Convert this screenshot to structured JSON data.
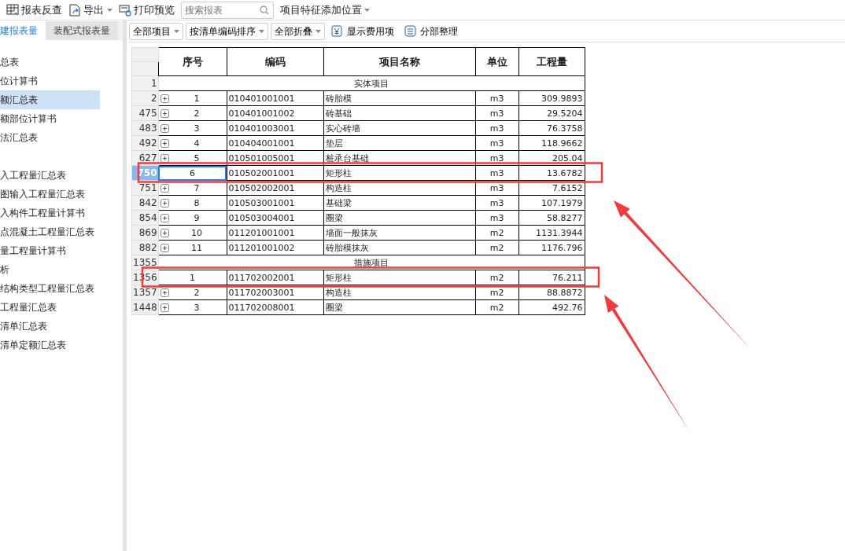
{
  "toolbar": {
    "items": [
      {
        "kind": "button",
        "label": "报表反查"
      },
      {
        "kind": "dropdown",
        "label": "导出"
      },
      {
        "kind": "button",
        "label": "打印预览"
      },
      {
        "kind": "search",
        "placeholder": "搜索报表"
      },
      {
        "kind": "select",
        "label": "项目特征添加位置"
      }
    ]
  },
  "sidebar": {
    "tabs": [
      {
        "label": "建报表量",
        "selected": true
      },
      {
        "label": "装配式报表量",
        "selected": false
      }
    ],
    "items": [
      {
        "label": "总表",
        "selected": false
      },
      {
        "label": "位计算书",
        "selected": false
      },
      {
        "label": "额汇总表",
        "selected": true
      },
      {
        "label": "额部位计算书",
        "selected": false
      },
      {
        "label": "法汇总表",
        "selected": false
      },
      {
        "label": "入工程量汇总表",
        "selected": false
      },
      {
        "label": "图输入工程量汇总表",
        "selected": false
      },
      {
        "label": "入构件工程量计算书",
        "selected": false
      },
      {
        "label": "点混凝土工程量汇总表",
        "selected": false
      },
      {
        "label": "量工程量计算书",
        "selected": false
      },
      {
        "label": "析",
        "selected": false
      },
      {
        "label": "结构类型工程量汇总表",
        "selected": false
      },
      {
        "label": "工程量汇总表",
        "selected": false
      },
      {
        "label": "清单汇总表",
        "selected": false
      },
      {
        "label": "清单定额汇总表",
        "selected": false
      }
    ]
  },
  "filters": [
    {
      "kind": "select",
      "label": "全部项目"
    },
    {
      "kind": "select",
      "label": "按清单编码排序"
    },
    {
      "kind": "select",
      "label": "全部折叠"
    },
    {
      "kind": "button",
      "label": "显示费用项"
    },
    {
      "kind": "button",
      "label": "分部整理"
    }
  ],
  "table": {
    "columns": [
      "序号",
      "编码",
      "项目名称",
      "单位",
      "工程量"
    ],
    "rows": [
      {
        "kind": "group",
        "row_number": "1",
        "label": "实体项目"
      },
      {
        "kind": "item",
        "row_number": "2",
        "expand_button": true,
        "selected": false,
        "index": "1",
        "code": "010401001001",
        "name": "砖胎模",
        "unit": "m3",
        "quantity": "309.9893"
      },
      {
        "kind": "item",
        "row_number": "475",
        "expand_button": true,
        "selected": false,
        "index": "2",
        "code": "010401001002",
        "name": "砖基础",
        "unit": "m3",
        "quantity": "29.5204"
      },
      {
        "kind": "item",
        "row_number": "483",
        "expand_button": true,
        "selected": false,
        "index": "3",
        "code": "010401003001",
        "name": "实心砖墙",
        "unit": "m3",
        "quantity": "76.3758"
      },
      {
        "kind": "item",
        "row_number": "492",
        "expand_button": true,
        "selected": false,
        "index": "4",
        "code": "010404001001",
        "name": "垫层",
        "unit": "m3",
        "quantity": "118.9662"
      },
      {
        "kind": "item",
        "row_number": "627",
        "expand_button": true,
        "selected": false,
        "index": "5",
        "code": "010501005001",
        "name": "桩承台基础",
        "unit": "m3",
        "quantity": "205.04"
      },
      {
        "kind": "item",
        "row_number": "750",
        "expand_button": false,
        "selected": true,
        "index": "6",
        "code": "010502001001",
        "name": "矩形柱",
        "unit": "m3",
        "quantity": "13.6782"
      },
      {
        "kind": "item",
        "row_number": "751",
        "expand_button": true,
        "selected": false,
        "index": "7",
        "code": "010502002001",
        "name": "构造柱",
        "unit": "m3",
        "quantity": "7.6152"
      },
      {
        "kind": "item",
        "row_number": "842",
        "expand_button": true,
        "selected": false,
        "index": "8",
        "code": "010503001001",
        "name": "基础梁",
        "unit": "m3",
        "quantity": "107.1979"
      },
      {
        "kind": "item",
        "row_number": "854",
        "expand_button": true,
        "selected": false,
        "index": "9",
        "code": "010503004001",
        "name": "圈梁",
        "unit": "m3",
        "quantity": "58.8277"
      },
      {
        "kind": "item",
        "row_number": "869",
        "expand_button": true,
        "selected": false,
        "index": "10",
        "code": "011201001001",
        "name": "墙面一般抹灰",
        "unit": "m2",
        "quantity": "1131.3944"
      },
      {
        "kind": "item",
        "row_number": "882",
        "expand_button": true,
        "selected": false,
        "index": "11",
        "code": "011201001002",
        "name": "砖胎模抹灰",
        "unit": "m2",
        "quantity": "1176.796"
      },
      {
        "kind": "group",
        "row_number": "1355",
        "label": "措施项目"
      },
      {
        "kind": "item",
        "row_number": "1356",
        "expand_button": false,
        "selected": false,
        "index": "1",
        "code": "011702002001",
        "name": "矩形柱",
        "unit": "m2",
        "quantity": "76.211"
      },
      {
        "kind": "item",
        "row_number": "1357",
        "expand_button": true,
        "selected": false,
        "index": "2",
        "code": "011702003001",
        "name": "构造柱",
        "unit": "m2",
        "quantity": "88.8872"
      },
      {
        "kind": "item",
        "row_number": "1448",
        "expand_button": true,
        "selected": false,
        "index": "3",
        "code": "011702008001",
        "name": "圈梁",
        "unit": "m2",
        "quantity": "492.76"
      }
    ]
  },
  "annotations": [
    {
      "kind": "box"
    },
    {
      "kind": "box"
    },
    {
      "kind": "arrow"
    },
    {
      "kind": "arrow"
    }
  ]
}
